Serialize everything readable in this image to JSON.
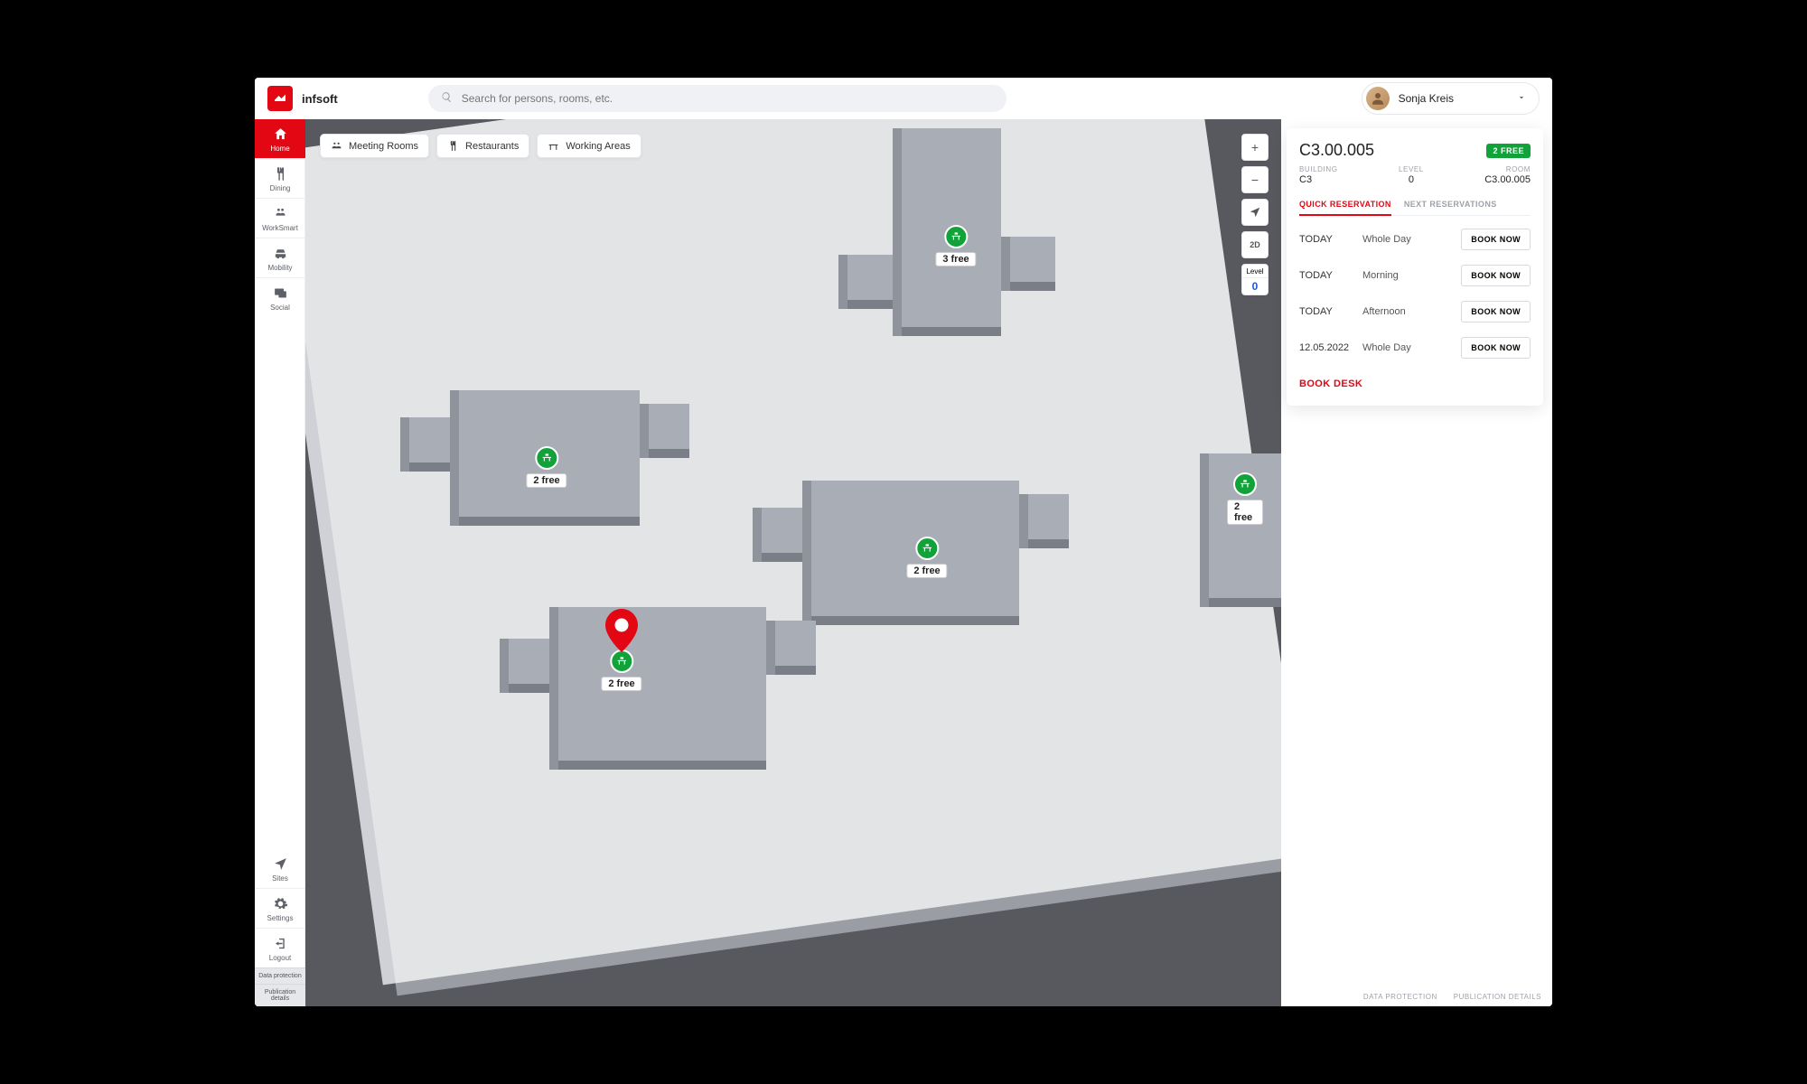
{
  "brand": "infsoft",
  "search": {
    "placeholder": "Search for persons, rooms, etc."
  },
  "user": {
    "name": "Sonja Kreis"
  },
  "sidebar": {
    "top": [
      {
        "label": "Home"
      },
      {
        "label": "Dining"
      },
      {
        "label": "WorkSmart"
      },
      {
        "label": "Mobility"
      },
      {
        "label": "Social"
      }
    ],
    "bottom": [
      {
        "label": "Sites"
      },
      {
        "label": "Settings"
      },
      {
        "label": "Logout"
      }
    ],
    "footer": [
      "Data protection",
      "Publication details"
    ]
  },
  "filters": [
    {
      "label": "Meeting Rooms"
    },
    {
      "label": "Restaurants"
    },
    {
      "label": "Working Areas"
    }
  ],
  "map_controls": {
    "zoom_in": "+",
    "zoom_out": "−",
    "mode": "2D",
    "level_label": "Level",
    "level_value": "0"
  },
  "desks": [
    {
      "label": "3 free"
    },
    {
      "label": "2 free"
    },
    {
      "label": "2 free"
    },
    {
      "label": "2 free"
    },
    {
      "label": "2 free"
    }
  ],
  "panel": {
    "room_code": "C3.00.005",
    "badge": "2 FREE",
    "meta": {
      "building_label": "BUILDING",
      "building_value": "C3",
      "level_label": "LEVEL",
      "level_value": "0",
      "room_label": "ROOM",
      "room_value": "C3.00.005"
    },
    "tabs": {
      "quick": "QUICK RESERVATION",
      "next": "NEXT RESERVATIONS"
    },
    "book_label": "BOOK NOW",
    "slots": [
      {
        "date": "TODAY",
        "period": "Whole Day"
      },
      {
        "date": "TODAY",
        "period": "Morning"
      },
      {
        "date": "TODAY",
        "period": "Afternoon"
      },
      {
        "date": "12.05.2022",
        "period": "Whole Day"
      }
    ],
    "book_desk": "BOOK DESK"
  },
  "bottom_links": {
    "data_protection": "DATA PROTECTION",
    "publication_details": "PUBLICATION DETAILS"
  }
}
